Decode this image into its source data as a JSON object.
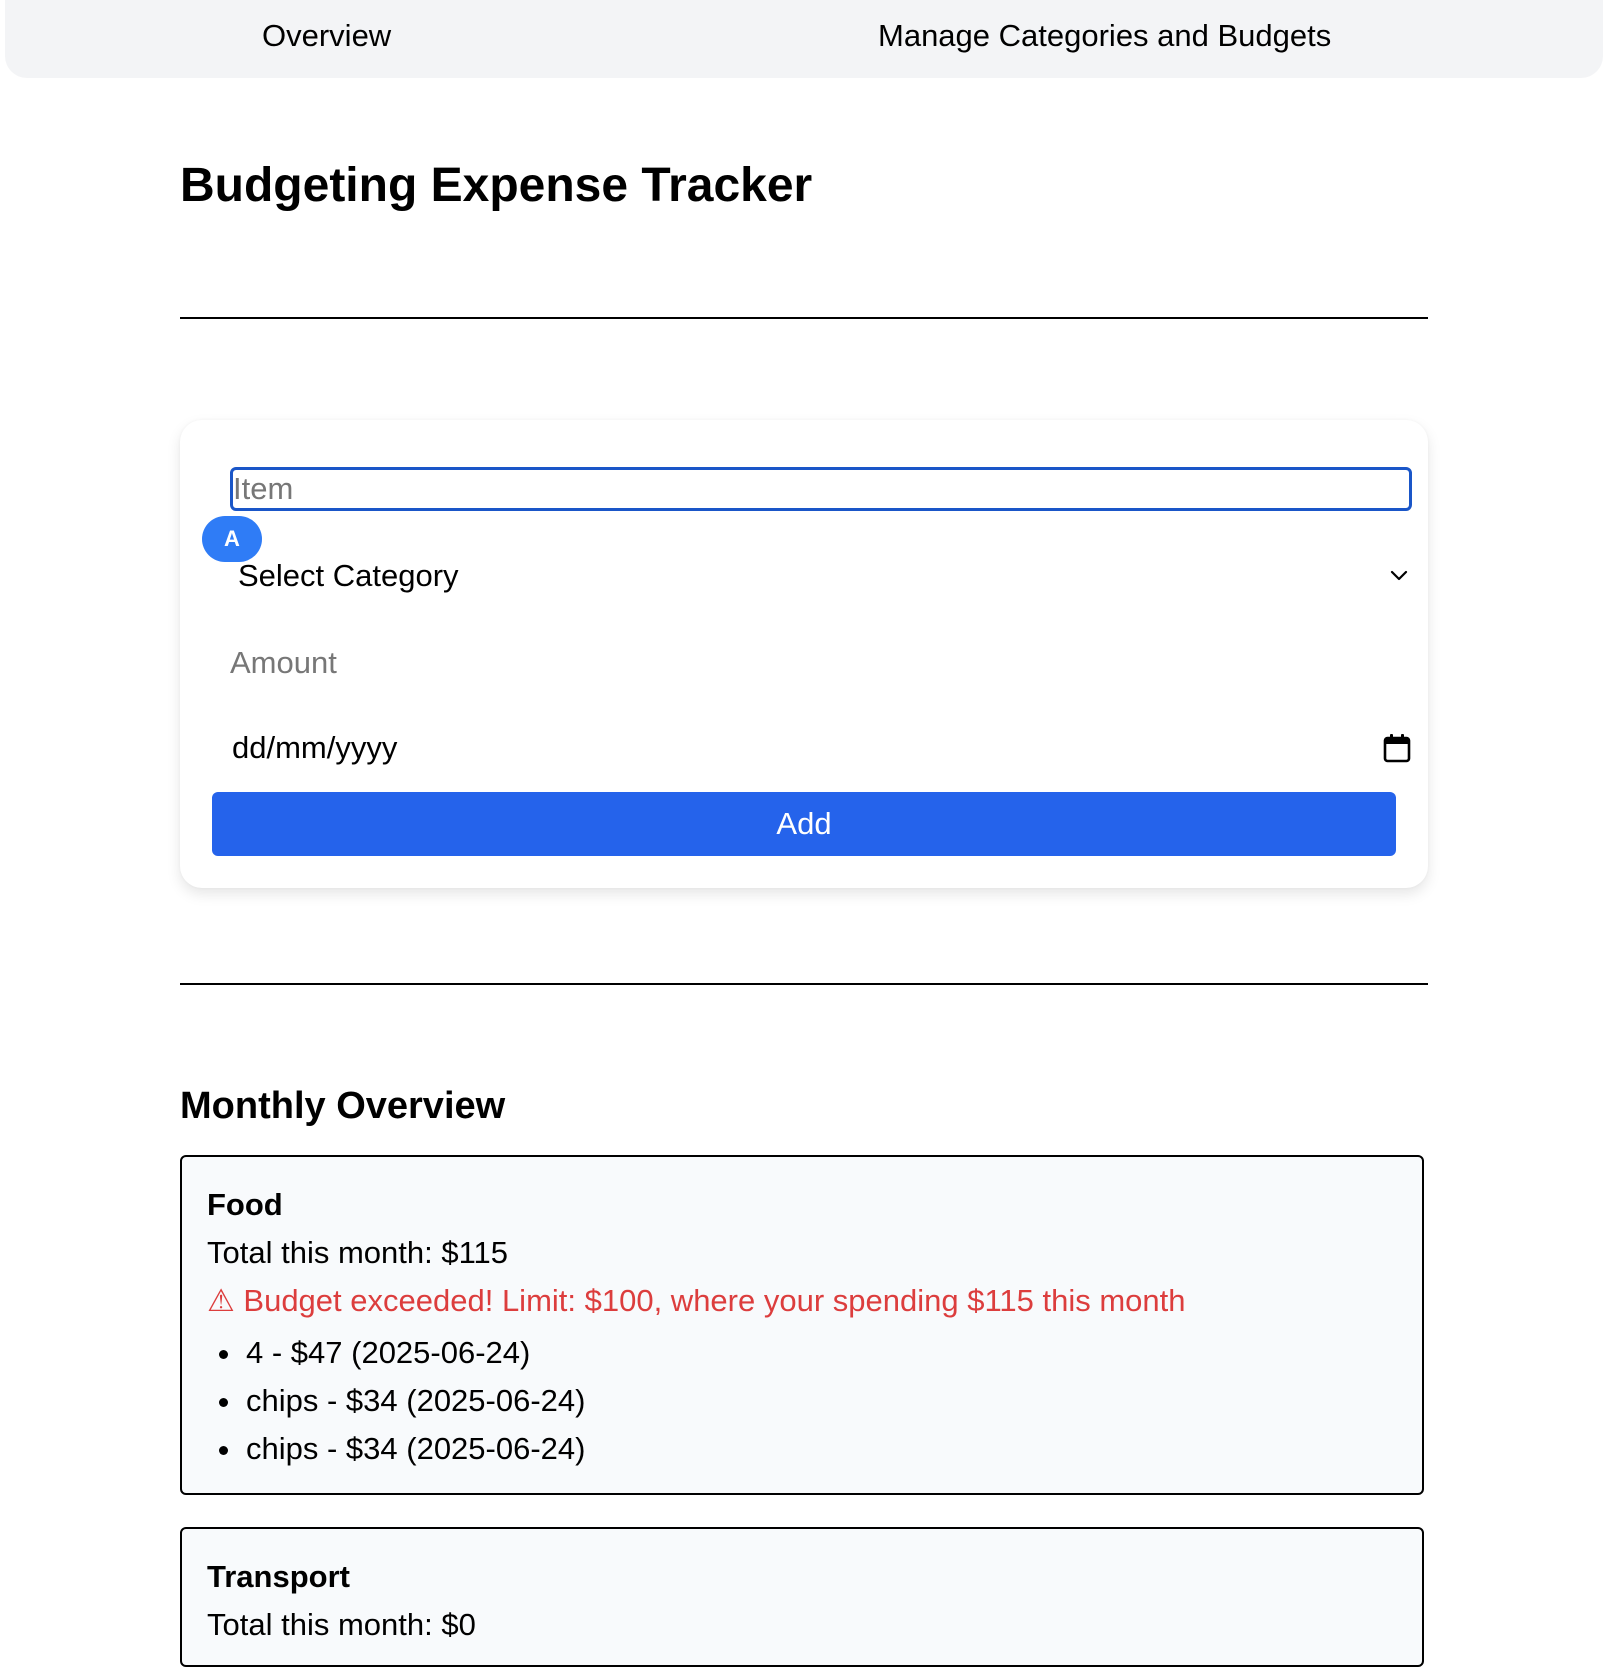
{
  "nav": {
    "overview_label": "Overview",
    "manage_label": "Manage Categories and Budgets"
  },
  "page": {
    "title": "Budgeting Expense Tracker"
  },
  "form": {
    "item_placeholder": "Item",
    "item_value": "",
    "avatar_letter": "A",
    "category_selected": "Select Category",
    "amount_placeholder": "Amount",
    "date_placeholder": "dd/mm/yyyy",
    "add_label": "Add"
  },
  "overview": {
    "title": "Monthly Overview",
    "categories": [
      {
        "name": "Food",
        "total": "Total this month: $115",
        "warning": "⚠ Budget exceeded! Limit: $100, where your spending $115 this month",
        "expenses": [
          "4 - $47 (2025-06-24)",
          "chips - $34 (2025-06-24)",
          "chips - $34 (2025-06-24)"
        ]
      },
      {
        "name": "Transport",
        "total": "Total this month: $0"
      }
    ]
  },
  "colors": {
    "accent": "#2563eb",
    "focus_border": "#1a56c8",
    "warning": "#dc3d3d",
    "nav_bg": "#f3f4f6",
    "card_bg": "#f8fafc"
  },
  "icons": {
    "select": "chevron-down-icon",
    "date": "calendar-icon",
    "warning": "warning-icon"
  }
}
